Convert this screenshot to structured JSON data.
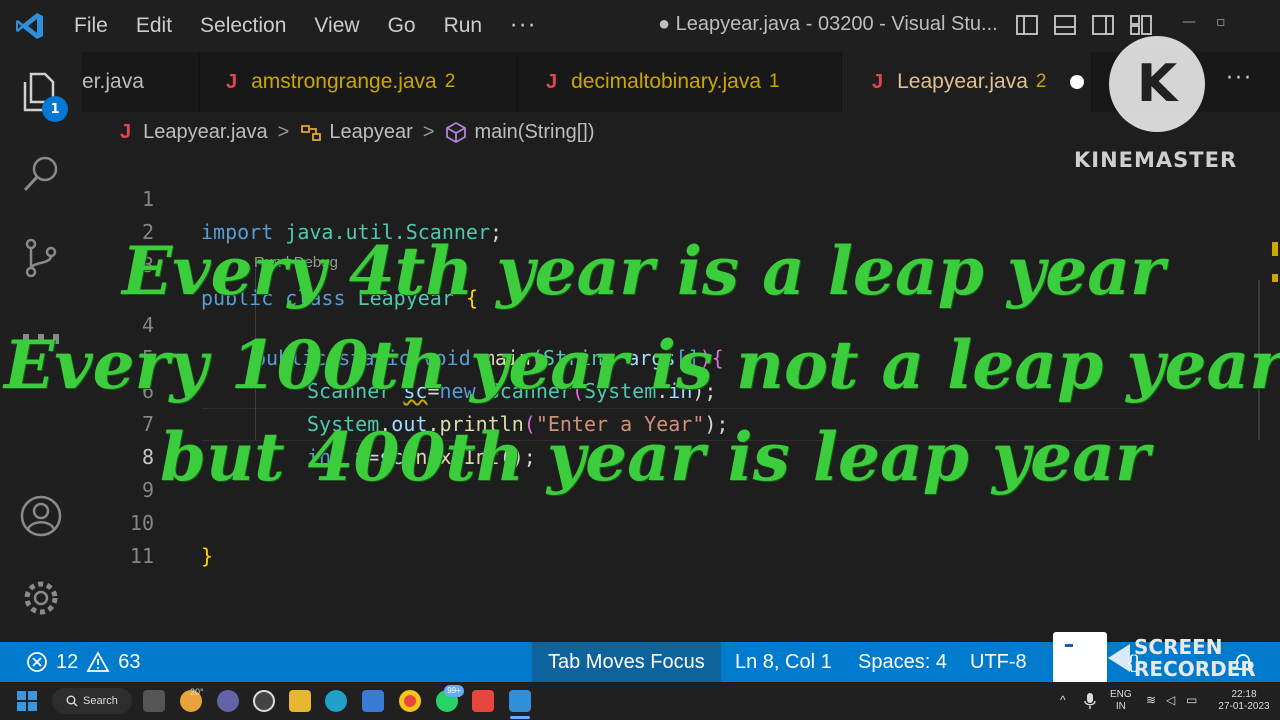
{
  "titlebar": {
    "menu": [
      "File",
      "Edit",
      "Selection",
      "View",
      "Go",
      "Run"
    ],
    "more": "···",
    "title": "● Leapyear.java - 03200 - Visual Stu..."
  },
  "activity": {
    "badge": "1"
  },
  "tabs": [
    {
      "name": "er.java",
      "count": ""
    },
    {
      "name": "amstrongrange.java",
      "count": "2"
    },
    {
      "name": "decimaltobinary.java",
      "count": "1"
    },
    {
      "name": "Leapyear.java",
      "count": "2"
    }
  ],
  "tab_icon": "J",
  "tab_more": "···",
  "breadcrumb": {
    "file": "Leapyear.java",
    "class": "Leapyear",
    "method": "main(String[])"
  },
  "editor": {
    "line_numbers": [
      "1",
      "2",
      "3",
      "4",
      "5",
      "6",
      "7",
      "8",
      "9",
      "10",
      "11"
    ],
    "codelens": "Run | Debug",
    "lines": {
      "l1": [
        "import",
        " java.util.",
        "Scanner",
        ";"
      ],
      "l3": [
        "public",
        " ",
        "class",
        " ",
        "Leapyear",
        " ",
        "{"
      ],
      "l4": [
        "public",
        " ",
        "static",
        " ",
        "void",
        " ",
        "main",
        "(",
        "String",
        " ",
        "args",
        "[]",
        ")",
        "{"
      ],
      "l5": [
        "Scanner",
        " ",
        "sc",
        "=",
        "new",
        " ",
        "Scanner",
        "(",
        "System",
        ".",
        "in",
        ");"
      ],
      "l6": [
        "System",
        ".",
        "out",
        ".",
        "println",
        "(",
        "\"Enter a Year\"",
        ");"
      ],
      "l7": [
        "int",
        " ",
        "y",
        "=",
        "sc",
        ".",
        "nextInt",
        "();"
      ],
      "l10": [
        "}"
      ]
    }
  },
  "overlay": {
    "line1": "Every 4th year is a leap year",
    "line2": "Every 100th year is not a leap year",
    "line3": "but 400th year is leap year"
  },
  "kinemaster": {
    "letter": "K",
    "label": "KINEMASTER"
  },
  "status": {
    "errors": "12",
    "warnings": "63",
    "tab_focus": "Tab Moves Focus",
    "position": "Ln 8, Col 1",
    "spaces": "Spaces: 4",
    "encoding": "UTF-8"
  },
  "recorder": {
    "line1": "SCREEN",
    "line2": "RECORDER"
  },
  "taskbar": {
    "search": "Search",
    "weather": "20°",
    "whatsapp_badge": "99+",
    "lang1": "ENG",
    "lang2": "IN",
    "time": "22:18",
    "date": "27-01-2023"
  },
  "colors": {
    "overlay_green": "#3ccd3c",
    "statusbar_blue": "#007acc",
    "keyword": "#569cd6",
    "type": "#4ec9b0",
    "java_icon": "#e0474c"
  }
}
